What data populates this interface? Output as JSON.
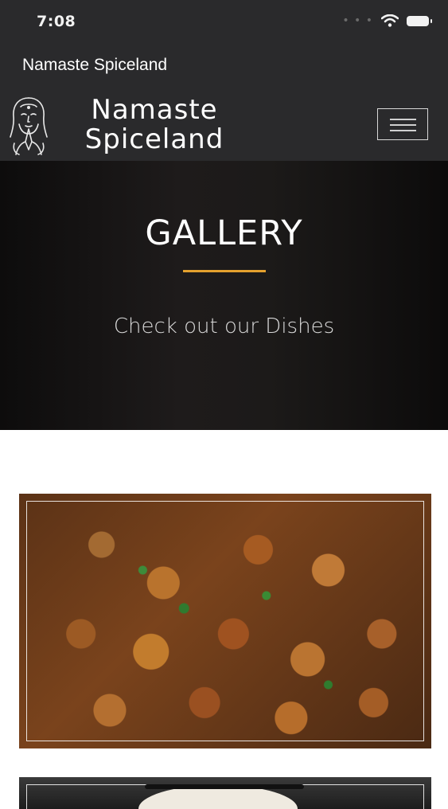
{
  "status_bar": {
    "time": "7:08"
  },
  "app_bar": {
    "title": "Namaste Spiceland"
  },
  "navbar": {
    "brand_line1": "Namaste",
    "brand_line2": "Spiceland",
    "logo_icon": "namaste-woman-logo-icon",
    "menu_icon": "hamburger-menu-icon"
  },
  "hero": {
    "title": "GALLERY",
    "subtitle": "Check out our Dishes",
    "accent_color": "#e4a12e"
  },
  "gallery": {
    "photos": [
      {
        "subject": "dish-photo"
      },
      {
        "subject": "dish-photo"
      }
    ]
  }
}
